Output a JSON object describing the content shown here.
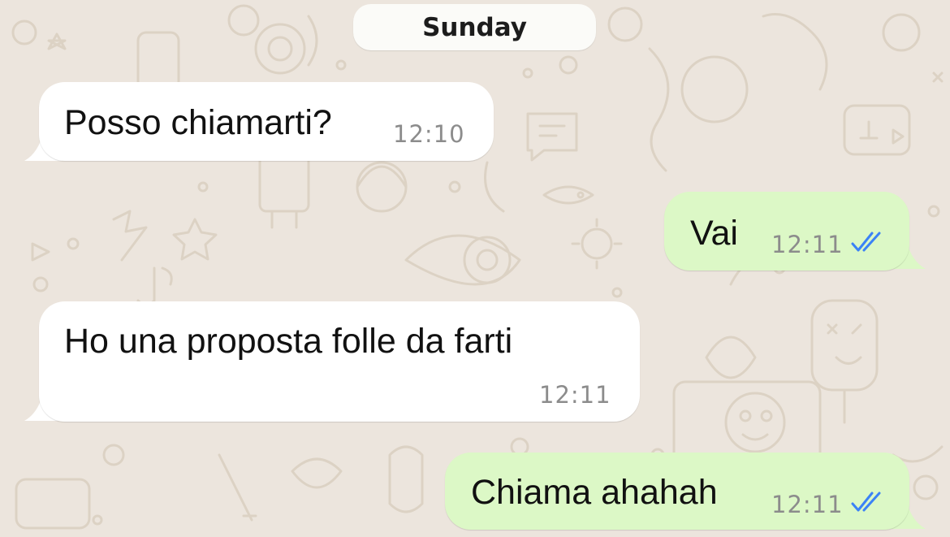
{
  "day_separator": "Sunday",
  "messages": [
    {
      "direction": "incoming",
      "text": "Posso chiamarti?",
      "time": "12:10"
    },
    {
      "direction": "outgoing",
      "text": "Vai",
      "time": "12:11",
      "status": "read"
    },
    {
      "direction": "incoming",
      "text": "Ho una proposta folle da farti",
      "time": "12:11"
    },
    {
      "direction": "outgoing",
      "text": "Chiama ahahah",
      "time": "12:11",
      "status": "read"
    }
  ],
  "colors": {
    "background": "#ECE5DD",
    "incoming_bubble": "#FFFFFF",
    "outgoing_bubble": "#DCF8C6",
    "read_ticks": "#3B82F6",
    "timestamp": "#8C8C8C"
  },
  "icons": [
    "double-check-icon"
  ]
}
